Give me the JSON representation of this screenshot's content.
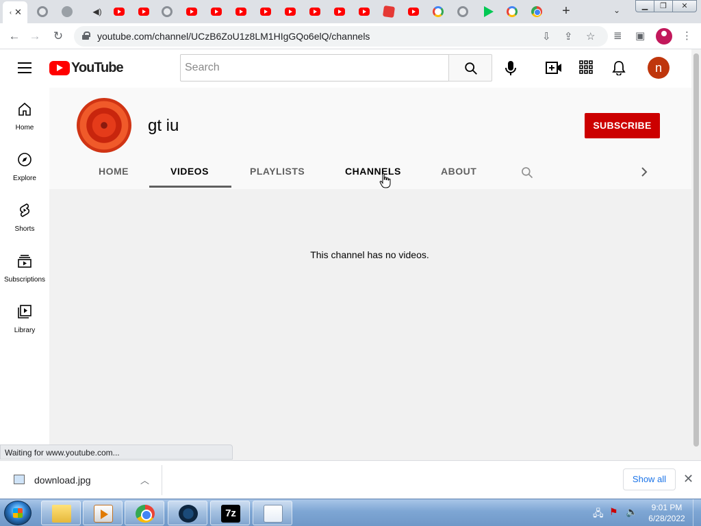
{
  "browser": {
    "tabs": [
      {
        "icon": "youtube-favicon",
        "active": true
      },
      {
        "icon": "globe-favicon"
      },
      {
        "icon": "magnifier-favicon"
      },
      {
        "icon": "speaker-favicon"
      },
      {
        "icon": "youtube-favicon"
      },
      {
        "icon": "youtube-favicon"
      },
      {
        "icon": "globe-favicon"
      },
      {
        "icon": "youtube-favicon"
      },
      {
        "icon": "youtube-favicon"
      },
      {
        "icon": "youtube-favicon"
      },
      {
        "icon": "youtube-favicon"
      },
      {
        "icon": "youtube-favicon"
      },
      {
        "icon": "youtube-favicon"
      },
      {
        "icon": "youtube-favicon"
      },
      {
        "icon": "youtube-favicon"
      },
      {
        "icon": "red-tile-favicon"
      },
      {
        "icon": "youtube-favicon"
      },
      {
        "icon": "google-favicon"
      },
      {
        "icon": "globe-favicon"
      },
      {
        "icon": "play-store-favicon"
      },
      {
        "icon": "google-favicon"
      },
      {
        "icon": "chrome-favicon"
      }
    ],
    "new_tab_label": "+",
    "url": "youtube.com/channel/UCzB6ZoU1z8LM1HIgGQo6elQ/channels"
  },
  "youtube": {
    "logo_text": "YouTube",
    "search_placeholder": "Search",
    "account_initial": "n",
    "guide": [
      {
        "label": "Home",
        "icon": "home-icon"
      },
      {
        "label": "Explore",
        "icon": "compass-icon"
      },
      {
        "label": "Shorts",
        "icon": "shorts-icon"
      },
      {
        "label": "Subscriptions",
        "icon": "subscriptions-icon"
      },
      {
        "label": "Library",
        "icon": "library-icon"
      }
    ],
    "channel": {
      "name": "gt iu",
      "subscribe_label": "SUBSCRIBE",
      "tabs": [
        "HOME",
        "VIDEOS",
        "PLAYLISTS",
        "CHANNELS",
        "ABOUT"
      ],
      "active_tab": "VIDEOS",
      "empty_message": "This channel has no videos."
    }
  },
  "status_text": "Waiting for www.youtube.com...",
  "download_shelf": {
    "file_name": "download.jpg",
    "show_all_label": "Show all"
  },
  "taskbar": {
    "apps": [
      "file-explorer",
      "media-player",
      "chrome",
      "steam",
      "7-zip",
      "notepad"
    ],
    "sevenzip_label": "7z",
    "time": "9:01 PM",
    "date": "6/28/2022"
  }
}
